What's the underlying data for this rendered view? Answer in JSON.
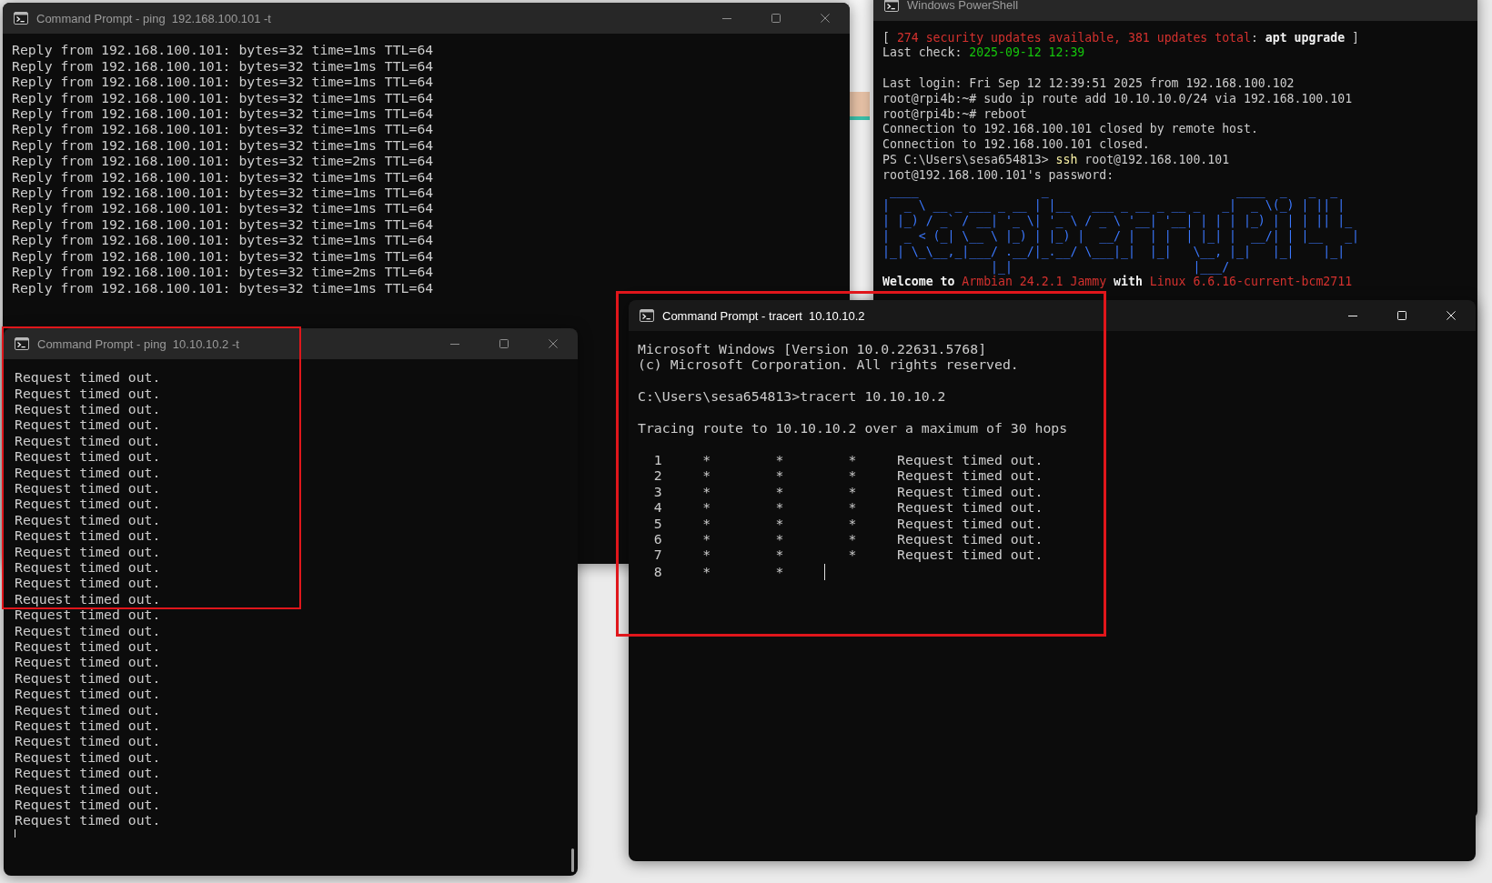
{
  "windows": [
    {
      "kind": "cmd",
      "title": "Command Prompt - ping  192.168.100.101 -t",
      "active": false,
      "window_buttons": true,
      "scrollbar": false,
      "cursor": false,
      "paragraphs": [
        [
          "Reply from 192.168.100.101: bytes=32 time=1ms TTL=64",
          "Reply from 192.168.100.101: bytes=32 time=1ms TTL=64",
          "Reply from 192.168.100.101: bytes=32 time=1ms TTL=64",
          "Reply from 192.168.100.101: bytes=32 time=1ms TTL=64",
          "Reply from 192.168.100.101: bytes=32 time=1ms TTL=64",
          "Reply from 192.168.100.101: bytes=32 time=1ms TTL=64",
          "Reply from 192.168.100.101: bytes=32 time=1ms TTL=64",
          "Reply from 192.168.100.101: bytes=32 time=2ms TTL=64",
          "Reply from 192.168.100.101: bytes=32 time=1ms TTL=64",
          "Reply from 192.168.100.101: bytes=32 time=1ms TTL=64",
          "Reply from 192.168.100.101: bytes=32 time=1ms TTL=64",
          "Reply from 192.168.100.101: bytes=32 time=1ms TTL=64",
          "Reply from 192.168.100.101: bytes=32 time=1ms TTL=64",
          "Reply from 192.168.100.101: bytes=32 time=1ms TTL=64",
          "Reply from 192.168.100.101: bytes=32 time=2ms TTL=64",
          "Reply from 192.168.100.101: bytes=32 time=1ms TTL=64"
        ]
      ]
    },
    {
      "kind": "powershell",
      "title": "Windows PowerShell",
      "active": false,
      "window_buttons": false,
      "scrollbar": false,
      "cursor": false,
      "paragraphs": [
        [
          [
            {
              "text": "[ ",
              "kind": "plain"
            },
            {
              "text": "274 security updates available, 381 updates total",
              "kind": "alert"
            },
            {
              "text": ": ",
              "kind": "plain"
            },
            {
              "text": "apt upgrade",
              "kind": "strong"
            },
            {
              "text": " ]",
              "kind": "plain"
            }
          ],
          [
            {
              "text": "Last check: ",
              "kind": "plain"
            },
            {
              "text": "2025-09-12 12:39",
              "kind": "ok"
            }
          ]
        ],
        [
          "Last login: Fri Sep 12 12:39:51 2025 from 192.168.100.102",
          "root@rpi4b:~# sudo ip route add 10.10.10.0/24 via 192.168.100.101",
          "root@rpi4b:~# reboot",
          "Connection to 192.168.100.101 closed by remote host.",
          "Connection to 192.168.100.101 closed.",
          [
            {
              "text": "PS C:\\Users\\sesa654813> ",
              "kind": "plain"
            },
            {
              "text": "ssh",
              "kind": "command"
            },
            {
              "text": " root@192.168.100.101",
              "kind": "plain"
            }
          ],
          "root@192.168.100.101's password:",
          {
            "kind": "banner",
            "lines": [
              " ____                 _                          ____  _   _  _",
              "|  _ \\ __ _ ___ _ __ | |__   ___ _ __ _ __ _   _|  _ \\(_) | || |",
              "| |_) / _` / __| '_ \\| '_ \\ / _ \\ '__| '__| | | | |_) | | | || |_",
              "|  _ < (_| \\__ \\ |_) | |_) |  __/ |  | |  | |_| |  __/| | |__   _|",
              "|_| \\_\\__,_|___/ .__/|_.__/ \\___|_|  |_|   \\__, |_|   |_|    |_|",
              "               |_|                         |___/"
            ]
          },
          [
            {
              "text": "Welcome to ",
              "kind": "strong"
            },
            {
              "text": "Armbian 24.2.1 Jammy",
              "kind": "alert"
            },
            {
              "text": " with ",
              "kind": "strong"
            },
            {
              "text": "Linux 6.6.16-current-bcm2711",
              "kind": "alert"
            }
          ]
        ]
      ]
    },
    {
      "kind": "cmd",
      "title": "Command Prompt - ping  10.10.10.2 -t",
      "active": false,
      "window_buttons": true,
      "scrollbar": true,
      "cursor": true,
      "cursor_new_line": true,
      "paragraphs": [
        [
          "Request timed out.",
          "Request timed out.",
          "Request timed out.",
          "Request timed out.",
          "Request timed out.",
          "Request timed out.",
          "Request timed out.",
          "Request timed out.",
          "Request timed out.",
          "Request timed out.",
          "Request timed out.",
          "Request timed out.",
          "Request timed out.",
          "Request timed out.",
          "Request timed out.",
          "Request timed out.",
          "Request timed out.",
          "Request timed out.",
          "Request timed out.",
          "Request timed out.",
          "Request timed out.",
          "Request timed out.",
          "Request timed out.",
          "Request timed out.",
          "Request timed out.",
          "Request timed out.",
          "Request timed out.",
          "Request timed out.",
          "Request timed out."
        ]
      ]
    },
    {
      "kind": "cmd",
      "title": "Command Prompt - tracert  10.10.10.2",
      "active": true,
      "window_buttons": true,
      "scrollbar": false,
      "cursor": true,
      "cursor_new_line": false,
      "paragraphs": [
        [
          "Microsoft Windows [Version 10.0.22631.5768]",
          "(c) Microsoft Corporation. All rights reserved."
        ],
        [
          "C:\\Users\\sesa654813>tracert 10.10.10.2"
        ],
        [
          "Tracing route to 10.10.10.2 over a maximum of 30 hops"
        ],
        [
          "  1     *        *        *     Request timed out.",
          "  2     *        *        *     Request timed out.",
          "  3     *        *        *     Request timed out.",
          "  4     *        *        *     Request timed out.",
          "  5     *        *        *     Request timed out.",
          "  6     *        *        *     Request timed out.",
          "  7     *        *        *     Request timed out.",
          "  8     *        *"
        ]
      ]
    }
  ],
  "annotations": [
    {
      "kind": "rectangle"
    },
    {
      "kind": "rectangle"
    }
  ]
}
